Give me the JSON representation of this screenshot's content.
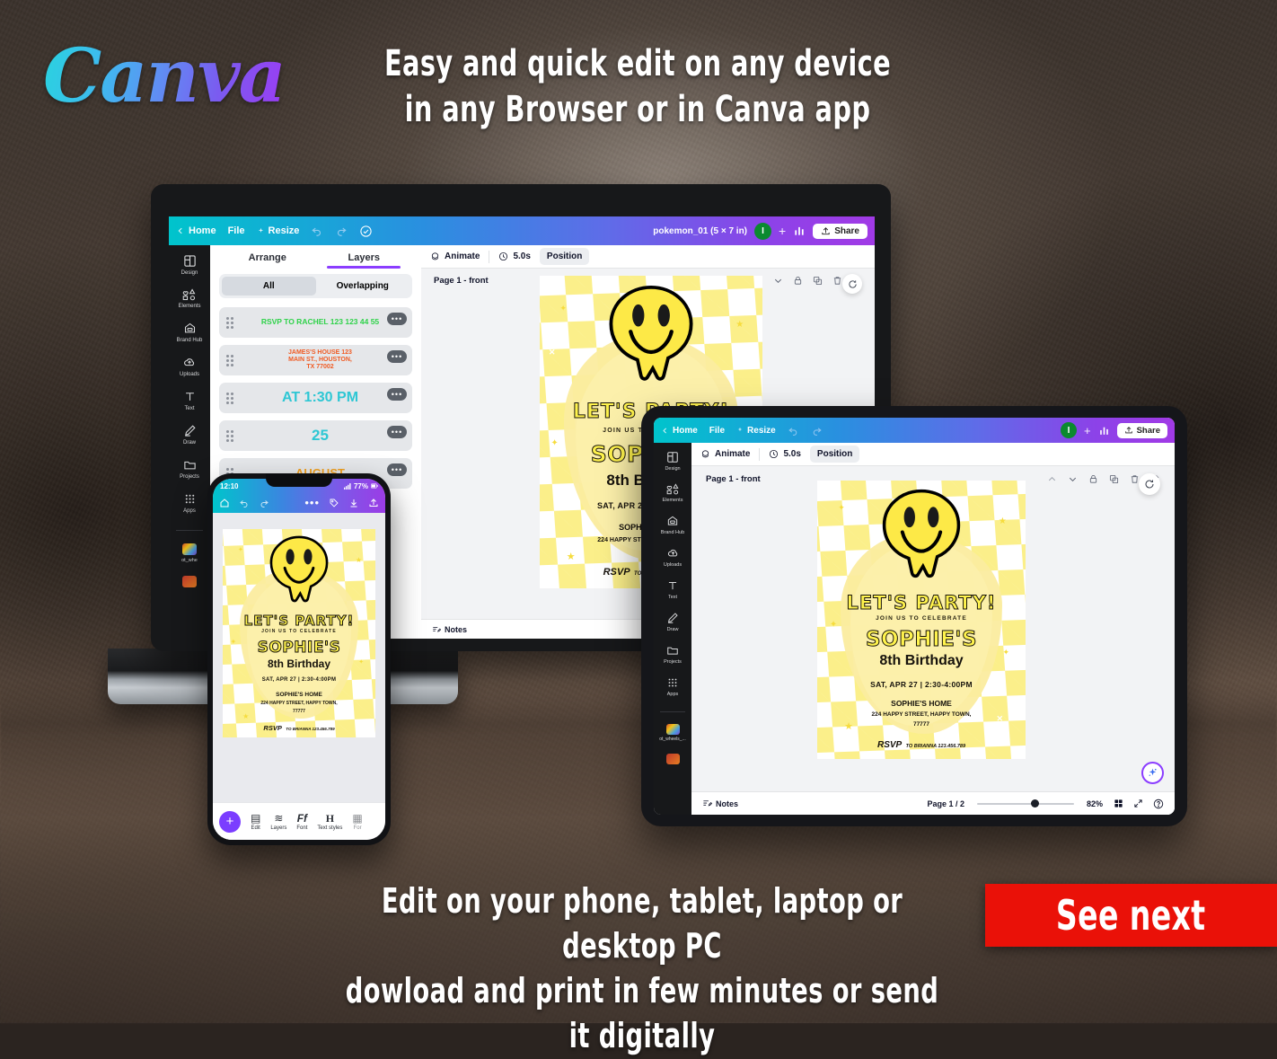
{
  "promo": {
    "logo": "Canva",
    "headline_line1": "Easy and quick edit on any device",
    "headline_line2": "in any Browser or in Canva app",
    "footer_line1": "Edit on your phone, tablet, laptop or desktop PC",
    "footer_line2": "dowload and print in few minutes or send it digitally",
    "see_next": "See next",
    "accent_red": "#ea1108",
    "brand_gradient_start": "#00c4cc",
    "brand_gradient_end": "#9b3ce6"
  },
  "topbar": {
    "home": "Home",
    "file": "File",
    "resize": "Resize",
    "undo_icon": "undo-icon",
    "redo_icon": "redo-icon",
    "cloud_icon": "cloud-saved-icon",
    "title": "pokemon_01 (5 × 7 in)",
    "avatar_initial": "I",
    "plus": "+",
    "insights_icon": "insights-icon",
    "share": "Share",
    "share_icon": "share-upload-icon"
  },
  "sidebar": {
    "items": [
      {
        "label": "Design",
        "icon": "design-icon"
      },
      {
        "label": "Elements",
        "icon": "elements-icon"
      },
      {
        "label": "Brand Hub",
        "icon": "brand-hub-icon"
      },
      {
        "label": "Uploads",
        "icon": "uploads-cloud-icon"
      },
      {
        "label": "Text",
        "icon": "text-icon"
      },
      {
        "label": "Draw",
        "icon": "draw-pen-icon"
      },
      {
        "label": "Projects",
        "icon": "projects-folder-icon"
      },
      {
        "label": "Apps",
        "icon": "apps-grid-icon"
      }
    ],
    "thumb_label": "ot_whe",
    "thumb_label_tablet": "ot_wheels_..."
  },
  "subbar": {
    "animate": "Animate",
    "animate_icon": "animate-icon",
    "duration": "5.0s",
    "duration_icon": "clock-icon",
    "position": "Position"
  },
  "panel": {
    "tabs": [
      {
        "label": "Arrange",
        "active": false
      },
      {
        "label": "Layers",
        "active": true
      }
    ],
    "segments": [
      {
        "label": "All",
        "active": true
      },
      {
        "label": "Overlapping",
        "active": false
      }
    ],
    "layers": [
      {
        "text": "RSVP TO RACHEL 123 123 44 55",
        "color": "#2fd24a",
        "size": 8.5
      },
      {
        "text": "JAMES'S HOUSE 123\nMAIN ST., HOUSTON,\nTX 77002",
        "color": "#f05a22",
        "size": 7
      },
      {
        "text": "AT 1:30 PM",
        "color": "#2ec7d4",
        "size": 16
      },
      {
        "text": "25",
        "color": "#2ec7d4",
        "size": 17
      },
      {
        "text": "AUGUST",
        "color": "#f0a020",
        "size": 13
      }
    ],
    "row_menu_icon": "more-options-icon",
    "drag_handle_icon": "drag-handle-icon"
  },
  "page_header": {
    "label": "Page 1 - front",
    "tools": [
      "move-up-icon",
      "move-down-icon",
      "lock-icon",
      "duplicate-icon",
      "delete-trash-icon",
      "add-page-icon"
    ],
    "comment_icon": "comment-icon"
  },
  "bottombar": {
    "notes": "Notes",
    "notes_icon": "notes-icon",
    "page_counter": "Page 1 / 2",
    "zoom_level": "82%",
    "grid_icon": "grid-view-icon",
    "fullscreen_icon": "fullscreen-icon",
    "help_icon": "help-icon"
  },
  "phone": {
    "time": "12:10",
    "battery": "77%",
    "toolbar_icons": [
      "home-icon",
      "undo-icon",
      "redo-icon",
      "more-options-icon",
      "tag-icon",
      "download-icon",
      "share-icon"
    ],
    "fab": "+",
    "tabs": [
      {
        "label": "Edit",
        "icon": "edit-icon"
      },
      {
        "label": "Layers",
        "icon": "layers-icon"
      },
      {
        "label": "Font",
        "icon": "font-icon"
      },
      {
        "label": "Text styles",
        "icon": "text-styles-icon"
      },
      {
        "label": "For",
        "icon": "format-icon"
      }
    ]
  },
  "invitation": {
    "title": "LET'S PARTY!",
    "subtitle": "JOIN US TO CELEBRATE",
    "name": "SOPHIE'S",
    "occasion": "8th Birthday",
    "datetime": "SAT, APR 27  |  2:30-4:00PM",
    "venue": "SOPHIE'S HOME",
    "address_line1": "224 HAPPY STREET, HAPPY TOWN,",
    "address_line2": "77777",
    "rsvp_label": "RSVP",
    "rsvp_value": "TO BRIANNA 123.456.789"
  },
  "magic_button": {
    "icon": "magic-sparkle-icon"
  }
}
